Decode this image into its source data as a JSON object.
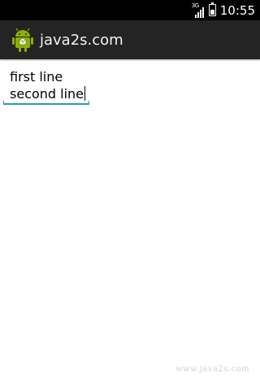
{
  "status_bar": {
    "network_type": "3G",
    "time": "10:55",
    "icons": [
      "signal-icon",
      "battery-charging-icon"
    ]
  },
  "action_bar": {
    "title": "java2s.com",
    "app_icon": "android-robot-icon"
  },
  "edit_text": {
    "line1": "first line",
    "line2": "second line"
  },
  "watermark": "www.java2s.com",
  "colors": {
    "status_bar": "#000000",
    "action_bar": "#242424",
    "edit_underline": "#2b9cb8",
    "background": "#ffffff",
    "android_green": "#8ab000"
  }
}
